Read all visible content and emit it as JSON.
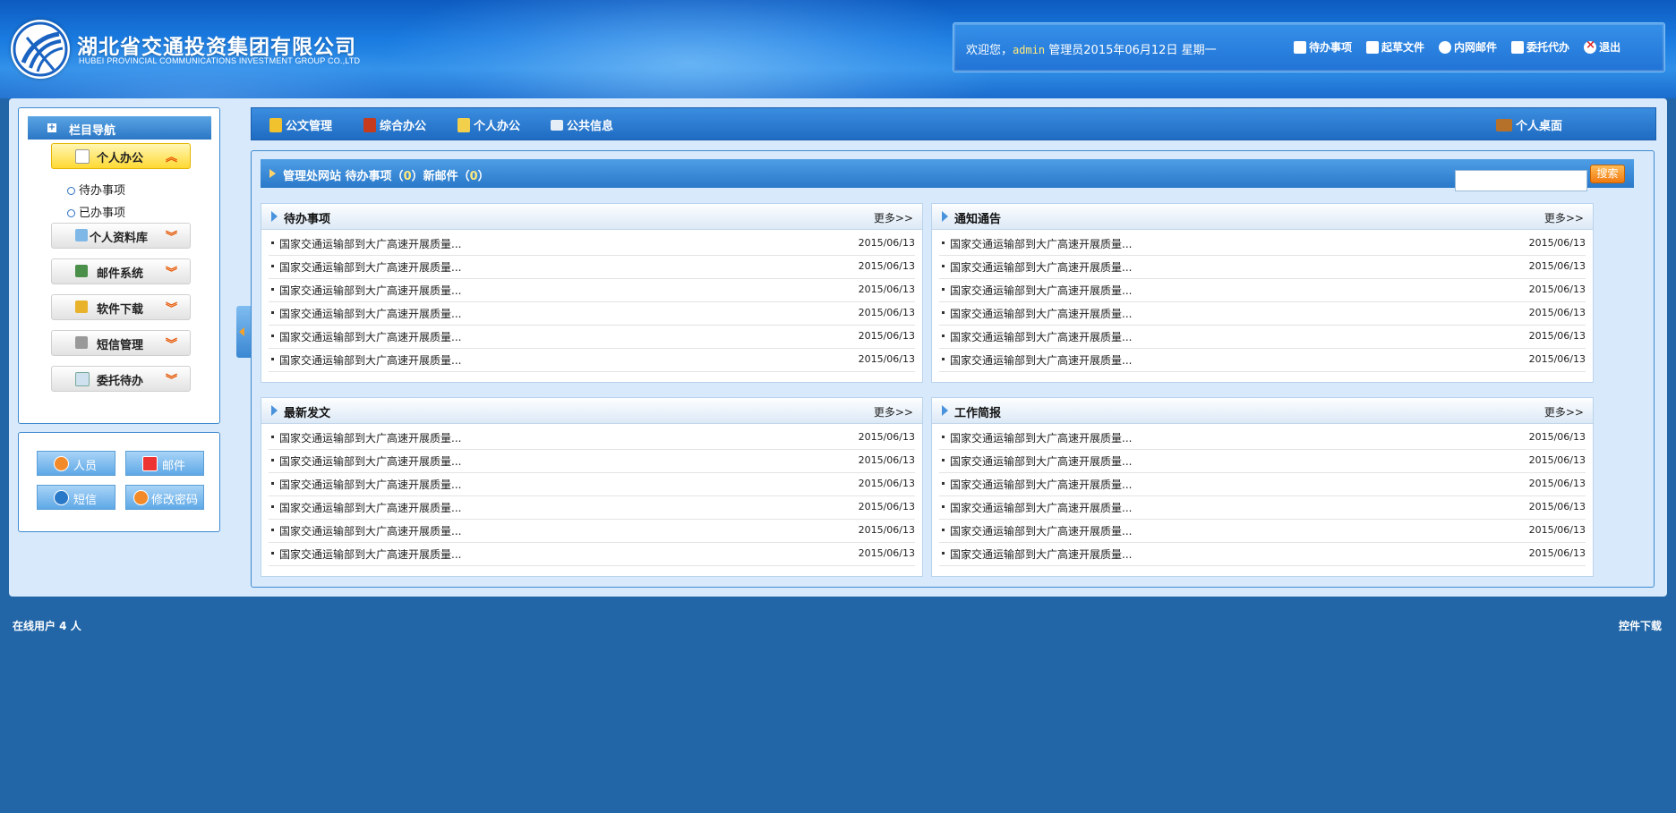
{
  "header": {
    "company_cn": "湖北省交通投资集团有限公司",
    "company_en": "HUBEI PROVINCIAL COMMUNICATIONS INVESTMENT GROUP CO.,LTD",
    "welcome_prefix": "欢迎您，",
    "username": "admin",
    "welcome_suffix": " 管理员2015年06月12日 星期一",
    "links": [
      {
        "label": "待办事项",
        "icon": "calendar-icon"
      },
      {
        "label": "起草文件",
        "icon": "document-icon"
      },
      {
        "label": "内网邮件",
        "icon": "mail-icon"
      },
      {
        "label": "委托代办",
        "icon": "delegate-icon"
      },
      {
        "label": "退出",
        "icon": "close-icon"
      }
    ]
  },
  "sidebar": {
    "title": "栏目导航",
    "items": [
      {
        "label": "个人办公",
        "active": true
      },
      {
        "label": "个人资料库"
      },
      {
        "label": "邮件系统"
      },
      {
        "label": "软件下载"
      },
      {
        "label": "短信管理"
      },
      {
        "label": "委托待办"
      }
    ],
    "subitems": [
      "待办事项",
      "已办事项"
    ],
    "quick": [
      "人员",
      "邮件",
      "短信",
      "修改密码"
    ]
  },
  "topmenu": {
    "items": [
      "公文管理",
      "综合办公",
      "个人办公",
      "公共信息"
    ],
    "right": "个人桌面"
  },
  "status": {
    "site": "管理处网站",
    "todo_label": "待办事项（",
    "todo_count": "0",
    "mail_label": "）新邮件（",
    "mail_count": "0",
    "close": "）",
    "search_button": "搜索"
  },
  "cards": [
    {
      "title": "待办事项",
      "more": "更多>>",
      "rows": [
        {
          "title": "国家交通运输部到大广高速开展质量...",
          "date": "2015/06/13"
        },
        {
          "title": "国家交通运输部到大广高速开展质量...",
          "date": "2015/06/13"
        },
        {
          "title": "国家交通运输部到大广高速开展质量...",
          "date": "2015/06/13"
        },
        {
          "title": "国家交通运输部到大广高速开展质量...",
          "date": "2015/06/13"
        },
        {
          "title": "国家交通运输部到大广高速开展质量...",
          "date": "2015/06/13"
        },
        {
          "title": "国家交通运输部到大广高速开展质量...",
          "date": "2015/06/13"
        }
      ]
    },
    {
      "title": "通知通告",
      "more": "更多>>",
      "rows": [
        {
          "title": "国家交通运输部到大广高速开展质量...",
          "date": "2015/06/13"
        },
        {
          "title": "国家交通运输部到大广高速开展质量...",
          "date": "2015/06/13"
        },
        {
          "title": "国家交通运输部到大广高速开展质量...",
          "date": "2015/06/13"
        },
        {
          "title": "国家交通运输部到大广高速开展质量...",
          "date": "2015/06/13"
        },
        {
          "title": "国家交通运输部到大广高速开展质量...",
          "date": "2015/06/13"
        },
        {
          "title": "国家交通运输部到大广高速开展质量...",
          "date": "2015/06/13"
        }
      ]
    },
    {
      "title": "最新发文",
      "more": "更多>>",
      "rows": [
        {
          "title": "国家交通运输部到大广高速开展质量...",
          "date": "2015/06/13"
        },
        {
          "title": "国家交通运输部到大广高速开展质量...",
          "date": "2015/06/13"
        },
        {
          "title": "国家交通运输部到大广高速开展质量...",
          "date": "2015/06/13"
        },
        {
          "title": "国家交通运输部到大广高速开展质量...",
          "date": "2015/06/13"
        },
        {
          "title": "国家交通运输部到大广高速开展质量...",
          "date": "2015/06/13"
        },
        {
          "title": "国家交通运输部到大广高速开展质量...",
          "date": "2015/06/13"
        }
      ]
    },
    {
      "title": "工作简报",
      "more": "更多>>",
      "rows": [
        {
          "title": "国家交通运输部到大广高速开展质量...",
          "date": "2015/06/13"
        },
        {
          "title": "国家交通运输部到大广高速开展质量...",
          "date": "2015/06/13"
        },
        {
          "title": "国家交通运输部到大广高速开展质量...",
          "date": "2015/06/13"
        },
        {
          "title": "国家交通运输部到大广高速开展质量...",
          "date": "2015/06/13"
        },
        {
          "title": "国家交通运输部到大广高速开展质量...",
          "date": "2015/06/13"
        },
        {
          "title": "国家交通运输部到大广高速开展质量...",
          "date": "2015/06/13"
        }
      ]
    }
  ],
  "footer": {
    "online": "在线用户 4 人",
    "download": "控件下载"
  }
}
